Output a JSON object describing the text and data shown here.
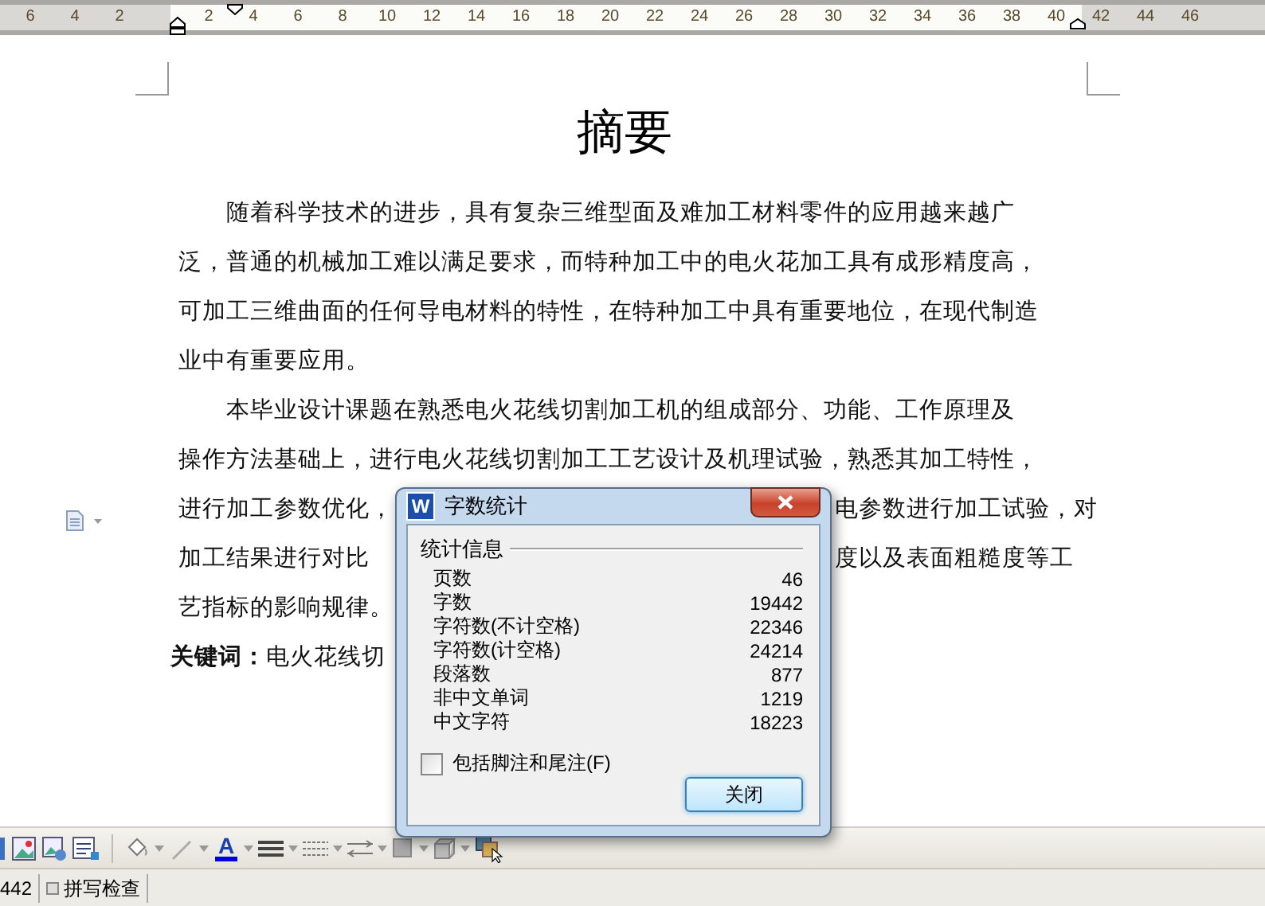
{
  "ruler": {
    "left_labels": [
      "6",
      "4",
      "2"
    ],
    "right_labels": [
      "2",
      "4",
      "6",
      "8",
      "10",
      "12",
      "14",
      "16",
      "18",
      "20",
      "22",
      "24",
      "26",
      "28",
      "30",
      "32",
      "34",
      "36",
      "38",
      "40",
      "42",
      "44",
      "46"
    ]
  },
  "document": {
    "title": "摘要",
    "lines": [
      {
        "kind": "indent",
        "text": "随着科学技术的进步，具有复杂三维型面及难加工材料零件的应用越来越广"
      },
      {
        "kind": "full",
        "text": "泛，普通的机械加工难以满足要求，而特种加工中的电火花加工具有成形精度高，"
      },
      {
        "kind": "full",
        "text": "可加工三维曲面的任何导电材料的特性，在特种加工中具有重要地位，在现代制造"
      },
      {
        "kind": "full",
        "text": "业中有重要应用。"
      },
      {
        "kind": "indent",
        "text": "本毕业设计课题在熟悉电火花线切割加工机的组成部分、功能、工作原理及"
      },
      {
        "kind": "full",
        "text": "操作方法基础上，进行电火花线切割加工工艺设计及机理试验，熟悉其加工特性，"
      },
      {
        "kind": "split",
        "left": "进行加工参数优化，",
        "right": "电参数进行加工试验，对"
      },
      {
        "kind": "split",
        "left": "加工结果进行对比",
        "right": "度以及表面粗糙度等工"
      },
      {
        "kind": "full",
        "text": "艺指标的影响规律。"
      }
    ],
    "keywords": {
      "label": "关键词：",
      "text": "电火花线切"
    }
  },
  "dialog": {
    "title": "字数统计",
    "app_icon_letter": "W",
    "group_label": "统计信息",
    "rows": [
      {
        "label": "页数",
        "value": "46"
      },
      {
        "label": "字数",
        "value": "19442"
      },
      {
        "label": "字符数(不计空格)",
        "value": "22346"
      },
      {
        "label": "字符数(计空格)",
        "value": "24214"
      },
      {
        "label": "段落数",
        "value": "877"
      },
      {
        "label": "非中文单词",
        "value": "1219"
      },
      {
        "label": "中文字符",
        "value": "18223"
      }
    ],
    "checkbox": {
      "label": "包括脚注和尾注(F)",
      "checked": false
    },
    "button": "关闭"
  },
  "toolbar": {
    "font_color_glyph": "A"
  },
  "status_bar": {
    "word_count": "442",
    "spell_check": "拼写检查"
  }
}
